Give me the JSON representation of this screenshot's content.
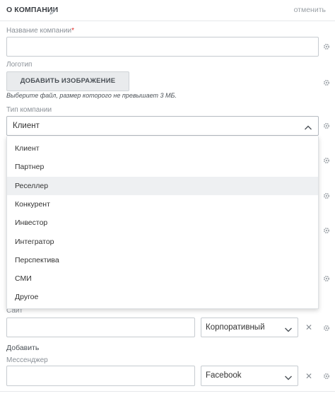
{
  "header": {
    "title": "О КОМПАНИИ",
    "cancel_label": "отменить"
  },
  "company_name": {
    "label": "Название компании",
    "required_mark": "*",
    "value": ""
  },
  "logo": {
    "label": "Логотип",
    "button_label": "ДОБАВИТЬ ИЗОБРАЖЕНИЕ",
    "hint": "Выберите файл, размер которого не превышает 3 МБ."
  },
  "company_type": {
    "label": "Тип компании",
    "selected": "Клиент",
    "highlighted": "Реселлер",
    "options": [
      "Клиент",
      "Партнер",
      "Реселлер",
      "Конкурент",
      "Инвестор",
      "Интегратор",
      "Перспектива",
      "СМИ",
      "Другое"
    ]
  },
  "site": {
    "label": "Сайт",
    "value": "",
    "type_selected": "Корпоративный"
  },
  "add_label": "Добавить",
  "messenger": {
    "label": "Мессенджер",
    "value": "",
    "type_selected": "Facebook"
  },
  "icons": {
    "gear": "gear-icon",
    "pencil": "pencil-icon",
    "chevron_up": "chevron-up-icon",
    "chevron_down": "chevron-down-icon",
    "remove": "close-icon"
  }
}
